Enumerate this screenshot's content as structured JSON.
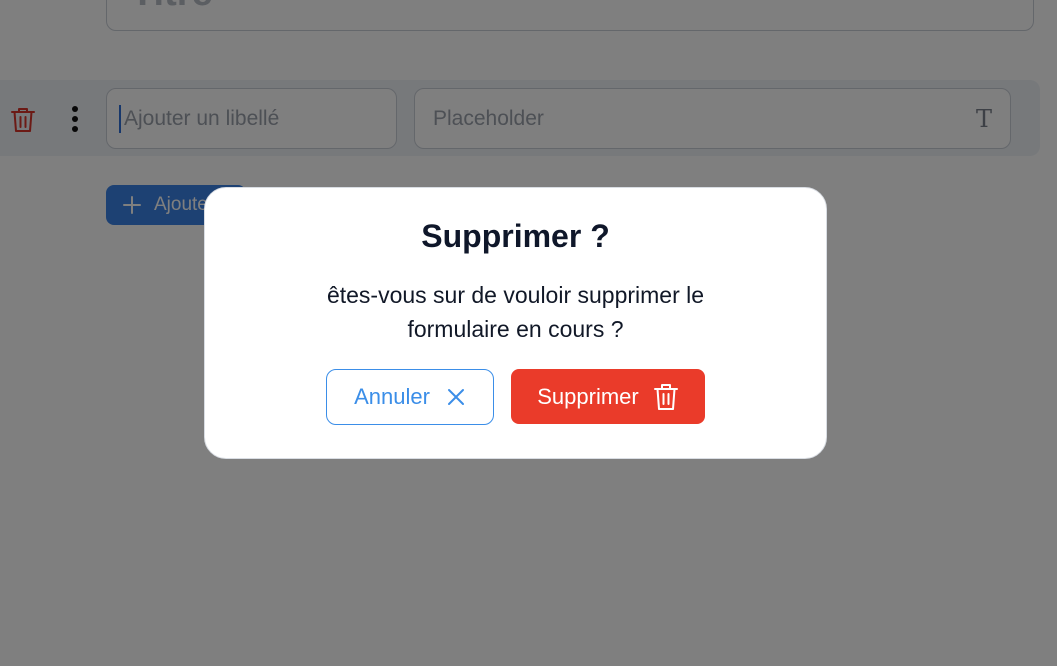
{
  "form": {
    "title_placeholder": "Titre",
    "field_row": {
      "trash_icon": "trash-icon",
      "menu_icon": "kebab-menu-icon",
      "label_placeholder": "Ajouter un libellé",
      "placeholder_value": "Placeholder",
      "type_icon_glyph": "T",
      "type_icon": "text-type-icon"
    },
    "add_button_label": "Ajouter"
  },
  "dialog": {
    "title": "Supprimer ?",
    "message": "êtes-vous sur de vouloir supprimer le formulaire en cours ?",
    "cancel_label": "Annuler",
    "cancel_icon": "close-icon",
    "confirm_label": "Supprimer",
    "confirm_icon": "trash-icon"
  },
  "colors": {
    "primary": "#3b82e6",
    "danger": "#ea3b2a",
    "overlay": "rgba(0,0,0,0.5)"
  }
}
